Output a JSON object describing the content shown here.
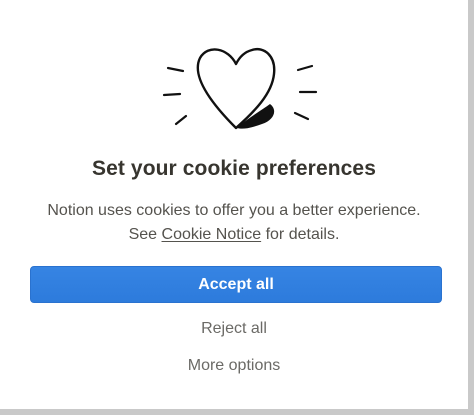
{
  "dialog": {
    "illustration_icon": "hand-drawn-heart-icon",
    "title": "Set your cookie preferences",
    "body_line1": "Notion uses cookies to offer you a better experience.",
    "body_prefix": "See",
    "cookie_notice_link": "Cookie Notice",
    "body_suffix": "for details.",
    "accept_label": "Accept all",
    "reject_label": "Reject all",
    "more_options_label": "More options"
  },
  "colors": {
    "accent": "#2f7ee0",
    "title": "#37352f",
    "body": "#55534e",
    "secondary": "#6b6a66"
  }
}
